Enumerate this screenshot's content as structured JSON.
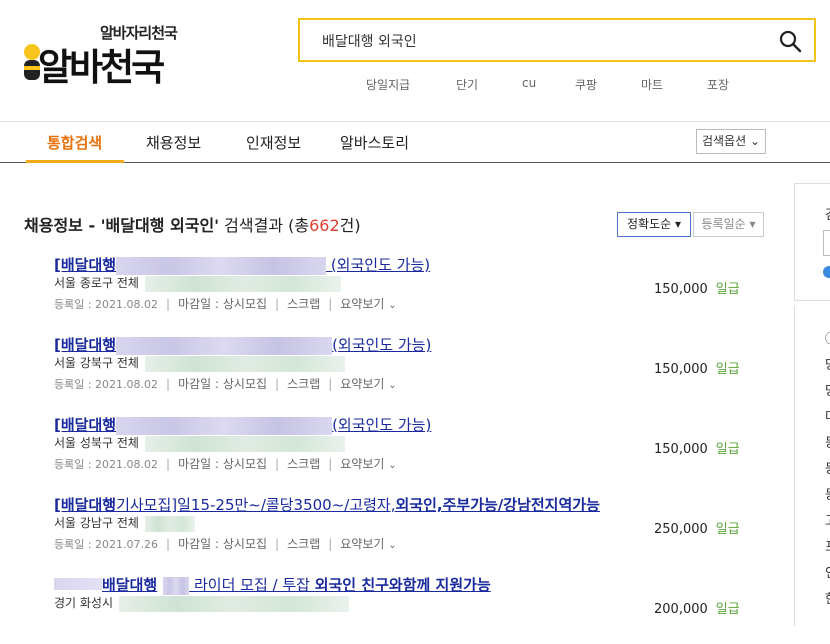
{
  "logo": {
    "small": "알바자리천국",
    "big": "알바천국"
  },
  "search": {
    "value": "배달대행 외국인",
    "placeholder": ""
  },
  "suggestions": [
    "당일지급",
    "단기",
    "cu",
    "쿠팡",
    "마트",
    "포장"
  ],
  "tabs": [
    "통합검색",
    "채용정보",
    "인재정보",
    "알바스토리"
  ],
  "search_option": "검색옵션",
  "result_header": {
    "prefix": "채용정보 - '배달대행 외국인'",
    "suffix1": " 검색결과 (총",
    "count": "662",
    "suffix2": "건)"
  },
  "sort": {
    "accuracy": "정확도순",
    "date": "등록일순"
  },
  "side_chars": [
    "검",
    "당",
    "당",
    "다",
    "등",
    "등",
    "등",
    "고",
    "포",
    "인",
    "한"
  ],
  "jobs": [
    {
      "title_kw": "[배달대행",
      "title_mid": "",
      "title_end": " (외국인도 가능)",
      "location": "서울 종로구 전체",
      "date": "등록일 : 2021.08.02",
      "deadline": "마감일 : 상시모집",
      "scrap": "스크랩",
      "summary": "요약보기",
      "pay": "150,000",
      "pay_unit": "일급"
    },
    {
      "title_kw": "[배달대행",
      "title_mid": "",
      "title_end": "(외국인도 가능)",
      "location": "서울 강북구 전체",
      "date": "등록일 : 2021.08.02",
      "deadline": "마감일 : 상시모집",
      "scrap": "스크랩",
      "summary": "요약보기",
      "pay": "150,000",
      "pay_unit": "일급"
    },
    {
      "title_kw": "[배달대행",
      "title_mid": "",
      "title_end": "(외국인도 가능)",
      "location": "서울 성북구 전체",
      "date": "등록일 : 2021.08.02",
      "deadline": "마감일 : 상시모집",
      "scrap": "스크랩",
      "summary": "요약보기",
      "pay": "150,000",
      "pay_unit": "일급"
    },
    {
      "title_kw": "[배달대행",
      "title_mid": "기사모집]일15-25만~/콜당3500~/고령자,",
      "title_end": "외국인,주부가능/강남전지역가능",
      "location": "서울 강남구 전체",
      "date": "등록일 : 2021.07.26",
      "deadline": "마감일 : 상시모집",
      "scrap": "스크랩",
      "summary": "요약보기",
      "pay": "250,000",
      "pay_unit": "일급"
    },
    {
      "title_kw": "배달대행",
      "title_mid": " 라이더 모집 / 투잡 ",
      "title_end": "외국인 친구와함께 지원가능",
      "location": "경기 화성시",
      "date": "",
      "deadline": "",
      "scrap": "",
      "summary": "",
      "pay": "200,000",
      "pay_unit": "일급"
    }
  ]
}
